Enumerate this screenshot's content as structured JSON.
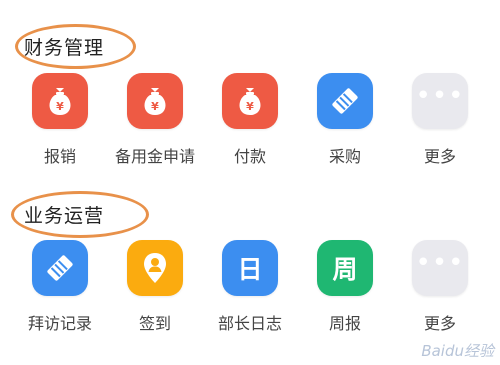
{
  "colors": {
    "red": "#ee5a44",
    "blue": "#3c8ef0",
    "orange": "#fbab0f",
    "green": "#1fb772",
    "gray": "#e9e9ee",
    "highlight": "#e8914a"
  },
  "sections": [
    {
      "title": "财务管理",
      "apps": [
        {
          "label": "报销",
          "icon": "money-bag-icon"
        },
        {
          "label": "备用金申请",
          "icon": "money-bag-icon"
        },
        {
          "label": "付款",
          "icon": "money-bag-icon"
        },
        {
          "label": "采购",
          "icon": "handshake-icon"
        },
        {
          "label": "更多",
          "icon": "more-dots-icon"
        }
      ]
    },
    {
      "title": "业务运营",
      "apps": [
        {
          "label": "拜访记录",
          "icon": "handshake-icon"
        },
        {
          "label": "签到",
          "icon": "location-pin-icon"
        },
        {
          "label": "部长日志",
          "icon": "day-calendar-icon",
          "glyph": "日"
        },
        {
          "label": "周报",
          "icon": "week-calendar-icon",
          "glyph": "周"
        },
        {
          "label": "更多",
          "icon": "more-dots-icon"
        }
      ]
    }
  ],
  "watermark": "Baidu经验"
}
